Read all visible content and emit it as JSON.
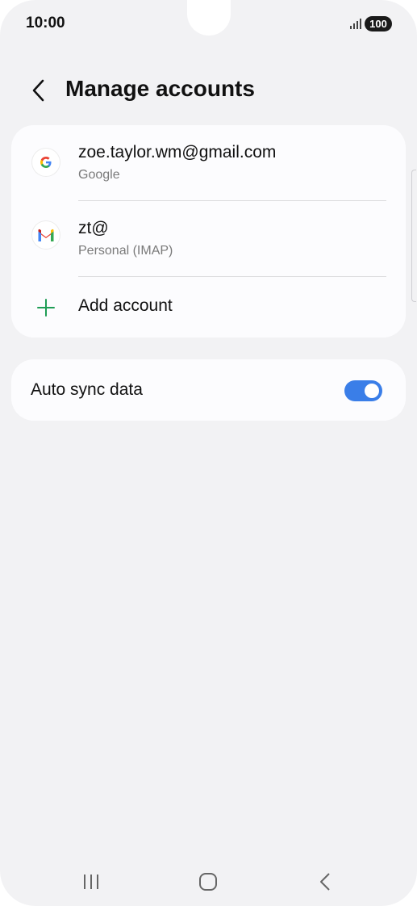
{
  "status_bar": {
    "time": "10:00",
    "battery": "100"
  },
  "header": {
    "title": "Manage accounts",
    "back_icon": "chevron-left-icon"
  },
  "accounts": [
    {
      "name": "zoe.taylor.wm@gmail.com",
      "type": "Google",
      "icon": "google-icon"
    },
    {
      "name": "zt@",
      "type": "Personal (IMAP)",
      "icon": "gmail-icon"
    }
  ],
  "add_account": {
    "label": "Add account",
    "icon": "plus-icon"
  },
  "auto_sync": {
    "label": "Auto sync data",
    "enabled": true
  },
  "nav_bar": {
    "recents_icon": "recents-icon",
    "home_icon": "home-icon",
    "back_icon": "back-icon"
  },
  "colors": {
    "background": "#f2f2f4",
    "card": "#fcfcfe",
    "accent": "#3a7ee8",
    "add_green": "#1f9d55",
    "subtext": "#7a7a7a"
  }
}
